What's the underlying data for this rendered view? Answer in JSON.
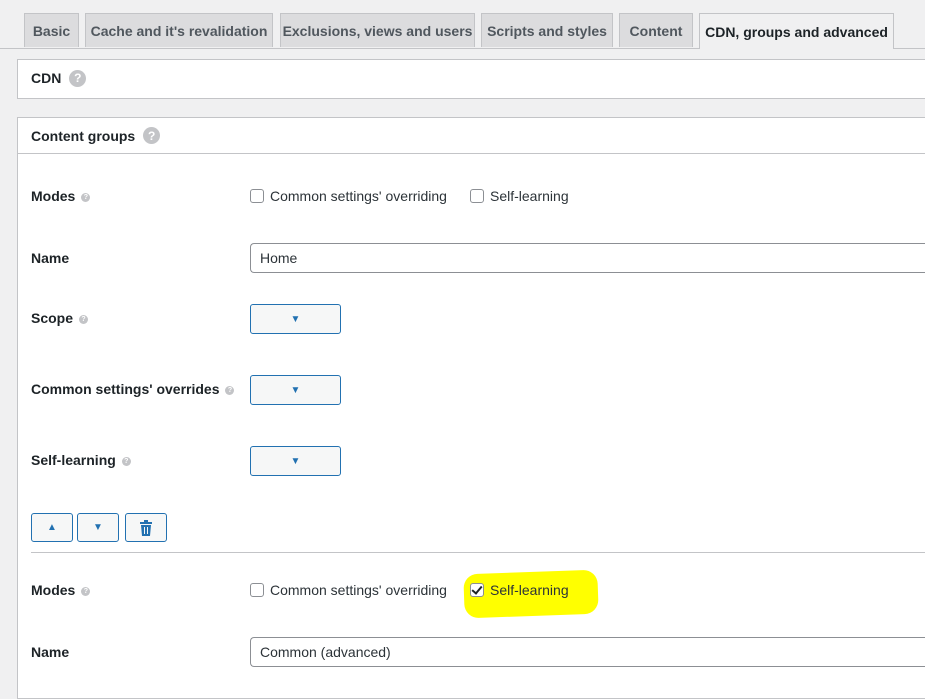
{
  "tabs": [
    {
      "label": "Basic",
      "active": false
    },
    {
      "label": "Cache and it's revalidation",
      "active": false
    },
    {
      "label": "Exclusions, views and users",
      "active": false
    },
    {
      "label": "Scripts and styles",
      "active": false
    },
    {
      "label": "Content",
      "active": false
    },
    {
      "label": "CDN, groups and advanced",
      "active": true
    }
  ],
  "cdn_panel": {
    "title": "CDN",
    "help_icon": "help-icon"
  },
  "groups_panel": {
    "title": "Content groups",
    "group1": {
      "modes_label": "Modes",
      "modes_options": [
        {
          "label": "Common settings' overriding",
          "checked": false
        },
        {
          "label": "Self-learning",
          "checked": false
        }
      ],
      "name_label": "Name",
      "name_value": "Home",
      "scope_label": "Scope",
      "overrides_label": "Common settings' overrides",
      "selflearning_label": "Self-learning",
      "dropdown_glyph": "▼"
    },
    "actions": {
      "up_glyph": "▲",
      "down_glyph": "▼",
      "delete_icon": "trash-icon"
    },
    "group2": {
      "modes_label": "Modes",
      "modes_options": [
        {
          "label": "Common settings' overriding",
          "checked": false
        },
        {
          "label": "Self-learning",
          "checked": true
        }
      ],
      "name_label": "Name",
      "name_value": "Common (advanced)"
    }
  },
  "colors": {
    "accent": "#2271b1",
    "highlight": "#ffff00",
    "background": "#f0f0f1"
  }
}
